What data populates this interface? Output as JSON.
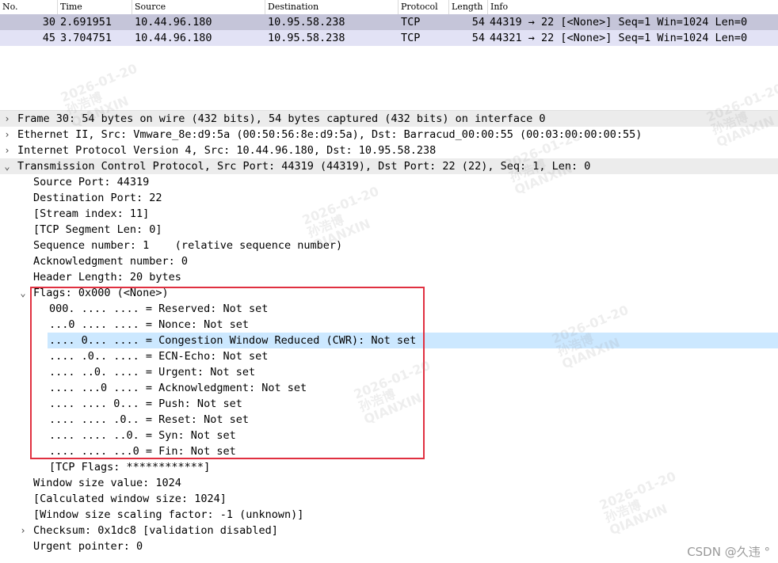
{
  "packet_list": {
    "columns": [
      "No.",
      "Time",
      "Source",
      "Destination",
      "Protocol",
      "Length",
      "Info"
    ],
    "rows": [
      {
        "no": "30",
        "time": "2.691951",
        "source": "10.44.96.180",
        "destination": "10.95.58.238",
        "protocol": "TCP",
        "length": "54",
        "info": "44319 → 22 [<None>] Seq=1 Win=1024 Len=0"
      },
      {
        "no": "45",
        "time": "3.704751",
        "source": "10.44.96.180",
        "destination": "10.95.58.238",
        "protocol": "TCP",
        "length": "54",
        "info": "44321 → 22 [<None>] Seq=1 Win=1024 Len=0"
      }
    ]
  },
  "details": {
    "frame": "Frame 30: 54 bytes on wire (432 bits), 54 bytes captured (432 bits) on interface 0",
    "ethernet": "Ethernet II, Src: Vmware_8e:d9:5a (00:50:56:8e:d9:5a), Dst: Barracud_00:00:55 (00:03:00:00:00:55)",
    "ip": "Internet Protocol Version 4, Src: 10.44.96.180, Dst: 10.95.58.238",
    "tcp": "Transmission Control Protocol, Src Port: 44319 (44319), Dst Port: 22 (22), Seq: 1, Len: 0",
    "tcp_fields_before": [
      "Source Port: 44319",
      "Destination Port: 22",
      "[Stream index: 11]",
      "[TCP Segment Len: 0]",
      "Sequence number: 1    (relative sequence number)",
      "Acknowledgment number: 0",
      "Header Length: 20 bytes"
    ],
    "flags_header": "Flags: 0x000 (<None>)",
    "flag_bits": [
      "000. .... .... = Reserved: Not set",
      "...0 .... .... = Nonce: Not set",
      ".... 0... .... = Congestion Window Reduced (CWR): Not set",
      ".... .0.. .... = ECN-Echo: Not set",
      ".... ..0. .... = Urgent: Not set",
      ".... ...0 .... = Acknowledgment: Not set",
      ".... .... 0... = Push: Not set",
      ".... .... .0.. = Reset: Not set",
      ".... .... ..0. = Syn: Not set",
      ".... .... ...0 = Fin: Not set"
    ],
    "tcp_flags_str": "[TCP Flags: ************]",
    "tcp_fields_after": [
      "Window size value: 1024",
      "[Calculated window size: 1024]",
      "[Window size scaling factor: -1 (unknown)]",
      "Checksum: 0x1dc8 [validation disabled]",
      "Urgent pointer: 0"
    ]
  },
  "watermark": {
    "date": "2026-01-20",
    "name": "孙浩博",
    "company": "QIANXIN"
  },
  "credit": "CSDN @久违 °",
  "icons": {
    "collapsed": "chevron-right-icon",
    "expanded": "chevron-down-icon"
  }
}
